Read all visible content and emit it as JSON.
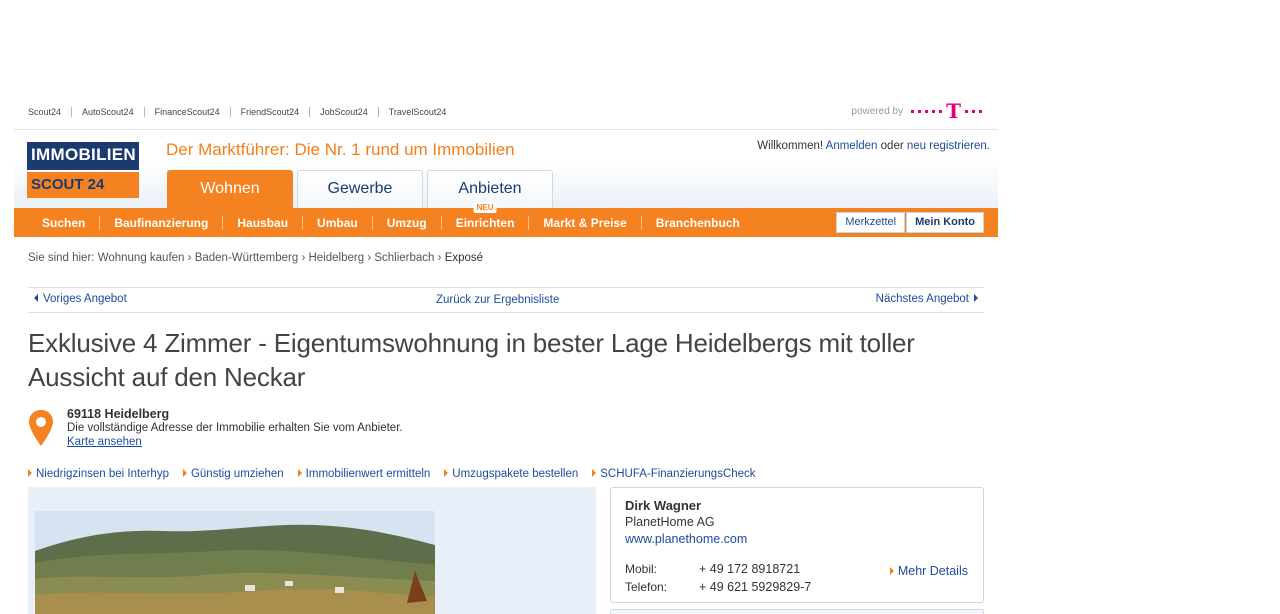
{
  "network": {
    "links": [
      "Scout24",
      "AutoScout24",
      "FinanceScout24",
      "FriendScout24",
      "JobScout24",
      "TravelScout24"
    ],
    "powered_by": "powered by",
    "telekom_logo": "T"
  },
  "header": {
    "logo_line1": "IMMOBILIEN",
    "logo_line2": "SCOUT 24",
    "tagline": "Der Marktführer: Die Nr. 1 rund um Immobilien",
    "welcome": "Willkommen!",
    "login": "Anmelden",
    "or": "oder",
    "register": "neu registrieren.",
    "tabs": [
      "Wohnen",
      "Gewerbe",
      "Anbieten"
    ]
  },
  "nav": {
    "items": [
      "Suchen",
      "Baufinanzierung",
      "Hausbau",
      "Umbau",
      "Umzug",
      "Einrichten",
      "Markt & Preise",
      "Branchenbuch"
    ],
    "new_badge": "NEU",
    "merkzettel": "Merkzettel",
    "mein_konto": "Mein Konto"
  },
  "breadcrumb": {
    "prefix": "Sie sind hier:",
    "items": [
      "Wohnung kaufen",
      "Baden-Württemberg",
      "Heidelberg",
      "Schlierbach"
    ],
    "current": "Exposé"
  },
  "pager": {
    "prev": "Voriges Angebot",
    "back": "Zurück zur Ergebnisliste",
    "next": "Nächstes Angebot"
  },
  "listing": {
    "title": "Exklusive 4 Zimmer - Eigentumswohnung in bester Lage Heidelbergs mit toller Aussicht auf den Neckar",
    "city": "69118 Heidelberg",
    "address_note": "Die vollständige Adresse der Immobilie erhalten Sie vom Anbieter.",
    "map_link": "Karte ansehen"
  },
  "services": [
    "Niedrigzinsen bei Interhyp",
    "Günstig umziehen",
    "Immobilienwert ermitteln",
    "Umzugspakete bestellen",
    "SCHUFA-FinanzierungsCheck"
  ],
  "contact": {
    "name": "Dirk Wagner",
    "company": "PlanetHome AG",
    "website": "www.planethome.com",
    "mobile_label": "Mobil:",
    "mobile": "+ 49 172 8918721",
    "phone_label": "Telefon:",
    "phone": "+ 49 621 5929829-7",
    "more": "Mehr Details"
  },
  "colors": {
    "brand_orange": "#f58220",
    "brand_navy": "#1b3b6f",
    "link_blue": "#1b4c9c",
    "telekom_magenta": "#e20074"
  }
}
